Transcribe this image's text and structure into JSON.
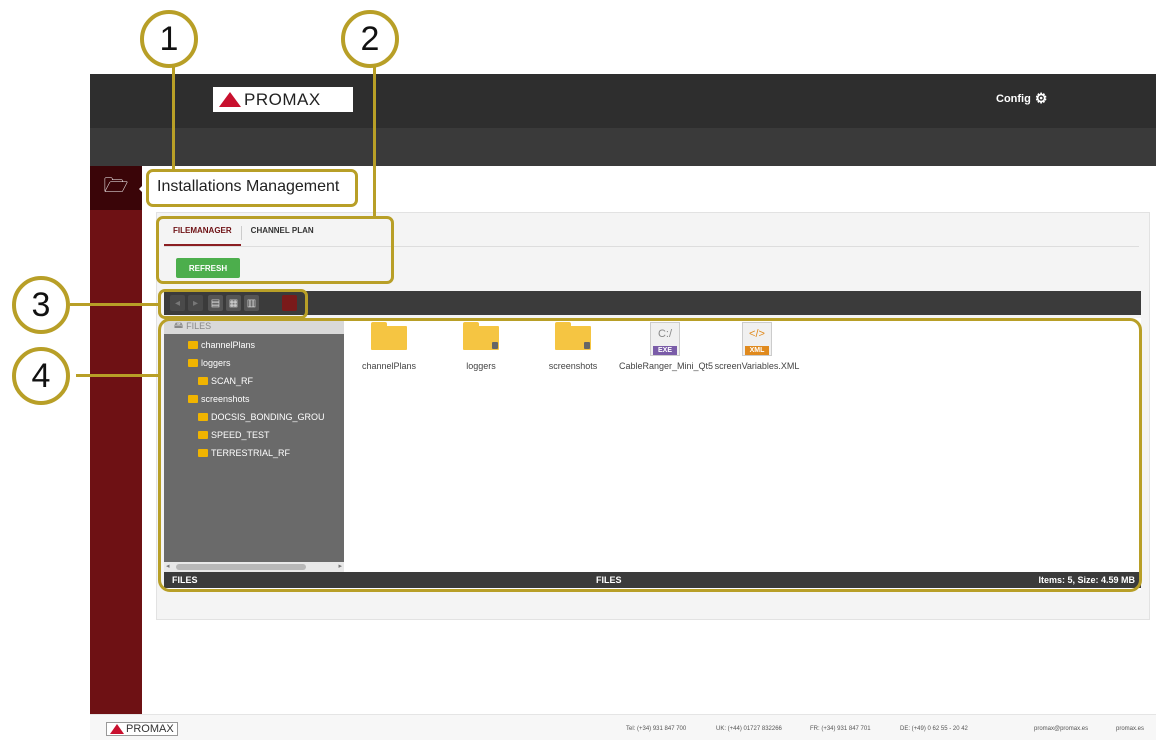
{
  "header": {
    "logo_text": "PROMAX",
    "config_label": "Config"
  },
  "page": {
    "title": "Installations Management"
  },
  "tabs": [
    {
      "label": "FILEMANAGER",
      "active": true
    },
    {
      "label": "CHANNEL PLAN",
      "active": false
    }
  ],
  "refresh_label": "REFRESH",
  "toolbar": {
    "buttons": [
      "back-icon",
      "forward-icon",
      "new-file-icon",
      "copy-icon",
      "paste-icon",
      "delete-icon"
    ]
  },
  "tree": {
    "root": "FILES",
    "items": [
      {
        "label": "channelPlans",
        "level": 1
      },
      {
        "label": "loggers",
        "level": 1
      },
      {
        "label": "SCAN_RF",
        "level": 2
      },
      {
        "label": "screenshots",
        "level": 1
      },
      {
        "label": "DOCSIS_BONDING_GROU",
        "level": 2
      },
      {
        "label": "SPEED_TEST",
        "level": 2
      },
      {
        "label": "TERRESTRIAL_RF",
        "level": 2
      }
    ]
  },
  "files": [
    {
      "name": "channelPlans",
      "type": "folder"
    },
    {
      "name": "loggers",
      "type": "folder"
    },
    {
      "name": "screenshots",
      "type": "folder"
    },
    {
      "name": "CableRanger_Mini_Qt5",
      "type": "exe",
      "tag": "EXE"
    },
    {
      "name": "screenVariables.XML",
      "type": "xml",
      "tag": "XML"
    }
  ],
  "statusbar": {
    "left": "FILES",
    "center": "FILES",
    "right": "Items: 5, Size: 4.59 MB"
  },
  "callouts": [
    "1",
    "2",
    "3",
    "4"
  ],
  "footer": {
    "logo_text": "PROMAX",
    "phones": [
      "Tel: (+34) 931 847 700",
      "UK: (+44) 01727 832266",
      "FR: (+34) 931 847 701",
      "DE: (+49) 0 62 55 - 20 42"
    ],
    "email": "promax@promax.es",
    "web": "promax.es"
  },
  "colors": {
    "accent": "#6e1114",
    "callout": "#b89f27",
    "refresh": "#4cae4c",
    "folder": "#f5c542"
  }
}
